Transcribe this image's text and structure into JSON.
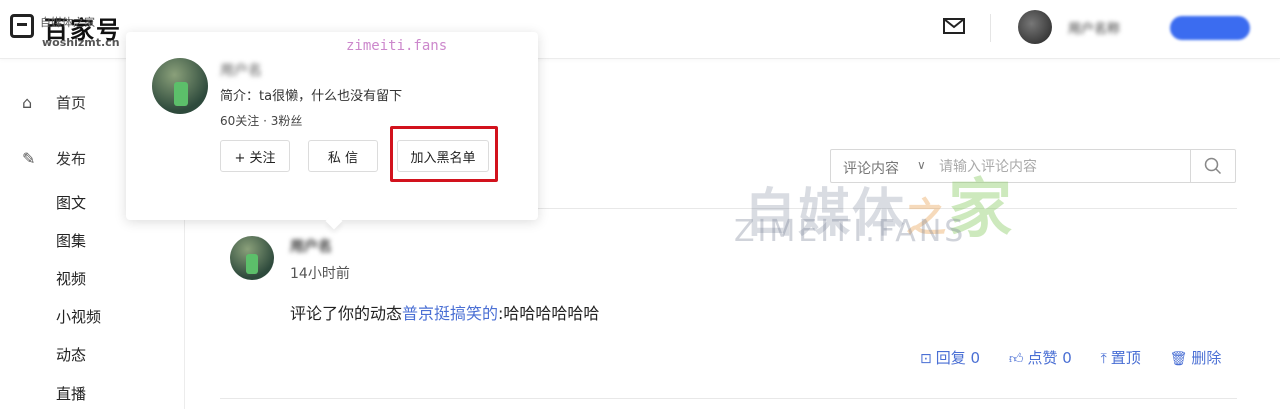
{
  "header": {
    "logo_text": "百家号",
    "logo_small": "自媒体之家",
    "logo_url": "woshizmt.cn",
    "user_name": "用户名称",
    "mail_icon": "mail-icon"
  },
  "sidebar": {
    "home": "首页",
    "publish": "发布",
    "items": [
      "图文",
      "图集",
      "视频",
      "小视频",
      "动态",
      "直播"
    ]
  },
  "search": {
    "type": "评论内容",
    "placeholder": "请输入评论内容"
  },
  "popup": {
    "name": "用户名",
    "intro": "简介：ta很懒，什么也没有留下",
    "stats": "60关注 · 3粉丝",
    "follow": "+ 关注",
    "message": "私 信",
    "blacklist": "加入黑名单",
    "watermark": "zimeiti.fans"
  },
  "post": {
    "name": "用户名",
    "time": "14小时前",
    "text_prefix": "评论了你的动态",
    "link": "普京挺搞笑的",
    "text_suffix": ":哈哈哈哈哈哈",
    "reply": "回复 0",
    "like": "点赞 0",
    "pin": "置顶",
    "delete": "删除"
  },
  "watermark": {
    "cn_a": "自媒体",
    "cn_b": "之",
    "cn_c": "家",
    "en": "ZIMEITI.FANS"
  },
  "colors": {
    "accent": "#4a6fd4",
    "highlight": "#d2121d",
    "brand_pill": "#3b6cf0"
  }
}
